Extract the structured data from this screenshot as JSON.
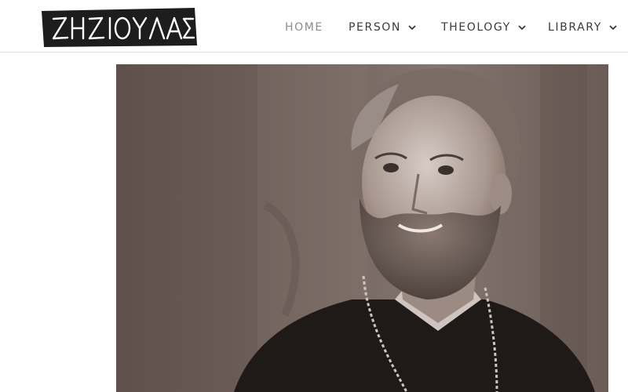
{
  "site": {
    "logo_text": "ΖΗΖΙΟΥΛΑΣ"
  },
  "nav": {
    "items": [
      {
        "label": "HOME",
        "active": true,
        "dropdown": false
      },
      {
        "label": "PERSON",
        "active": false,
        "dropdown": true
      },
      {
        "label": "THEOLOGY",
        "active": false,
        "dropdown": true
      },
      {
        "label": "LIBRARY",
        "active": false,
        "dropdown": true
      }
    ]
  },
  "colors": {
    "logo_bg": "#1d1d1d",
    "nav_text": "#3a3a3a",
    "nav_active": "#8c8c8c",
    "photo_tone": "#6e5f5a"
  },
  "icons": {
    "dropdown": "chevron-down-icon"
  }
}
